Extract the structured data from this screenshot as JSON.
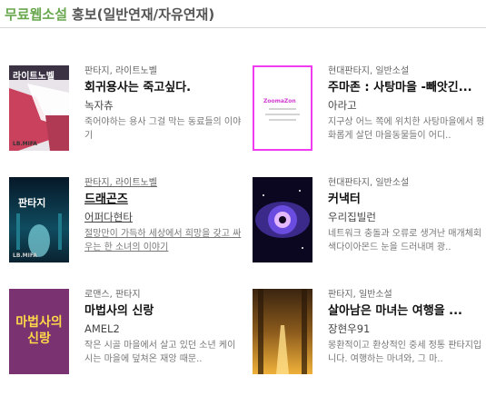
{
  "header": {
    "brand": "무료웹소설",
    "subtitle": "홍보(일반연재/자유연재)"
  },
  "cards": [
    {
      "genre": "판타지, 라이트노벨",
      "title": "회귀용사는 죽고싶다.",
      "author": "녹자츄",
      "desc": "죽어야하는 용사 그걸 막는 동료들의 이야기",
      "cover_title": "라이트노벨",
      "cover_tag": "LB.MIFA"
    },
    {
      "genre": "현대판타지, 일반소설",
      "title": "주마존 : 사탕마을 -빼앗긴...",
      "author": "아라고",
      "desc": "지구상 어느 쪽에 위치한 사탕마을에서 평화롭게 살던 마을동물들이 어디..",
      "cover_title": "ZoomaZon"
    },
    {
      "genre": "판타지, 라이트노벨",
      "title": "드래곤즈",
      "author": "어퍼다현타",
      "desc": "절망만이 가득하 세상에서 희망을 갖고 싸우는 한 소녀의 이야기",
      "cover_title": "판타지",
      "cover_tag": "LB.MIFA"
    },
    {
      "genre": "현대판타지, 일반소설",
      "title": "커낵터",
      "author": "우리집빌런",
      "desc": "네트워크 충돌과 오류로 생겨난 매개체회색다이아몬드 눈을 드러내며 광..",
      "cover_title": ""
    },
    {
      "genre": "로맨스, 판타지",
      "title": "마법사의 신랑",
      "author": "AMEL2",
      "desc": "작은 시골 마을에서 살고 있던 소년 케이시는 마을에 덮쳐온 재앙 때문..",
      "cover_title": "마법사의 신랑"
    },
    {
      "genre": "판타지, 일반소설",
      "title": "살아남은 마녀는 여행을 ...",
      "author": "장현우91",
      "desc": "몽환적이고 환상적인 중세 정통 판타지입니다. 여행하는 마녀와, 그 마..",
      "cover_title": ""
    }
  ]
}
